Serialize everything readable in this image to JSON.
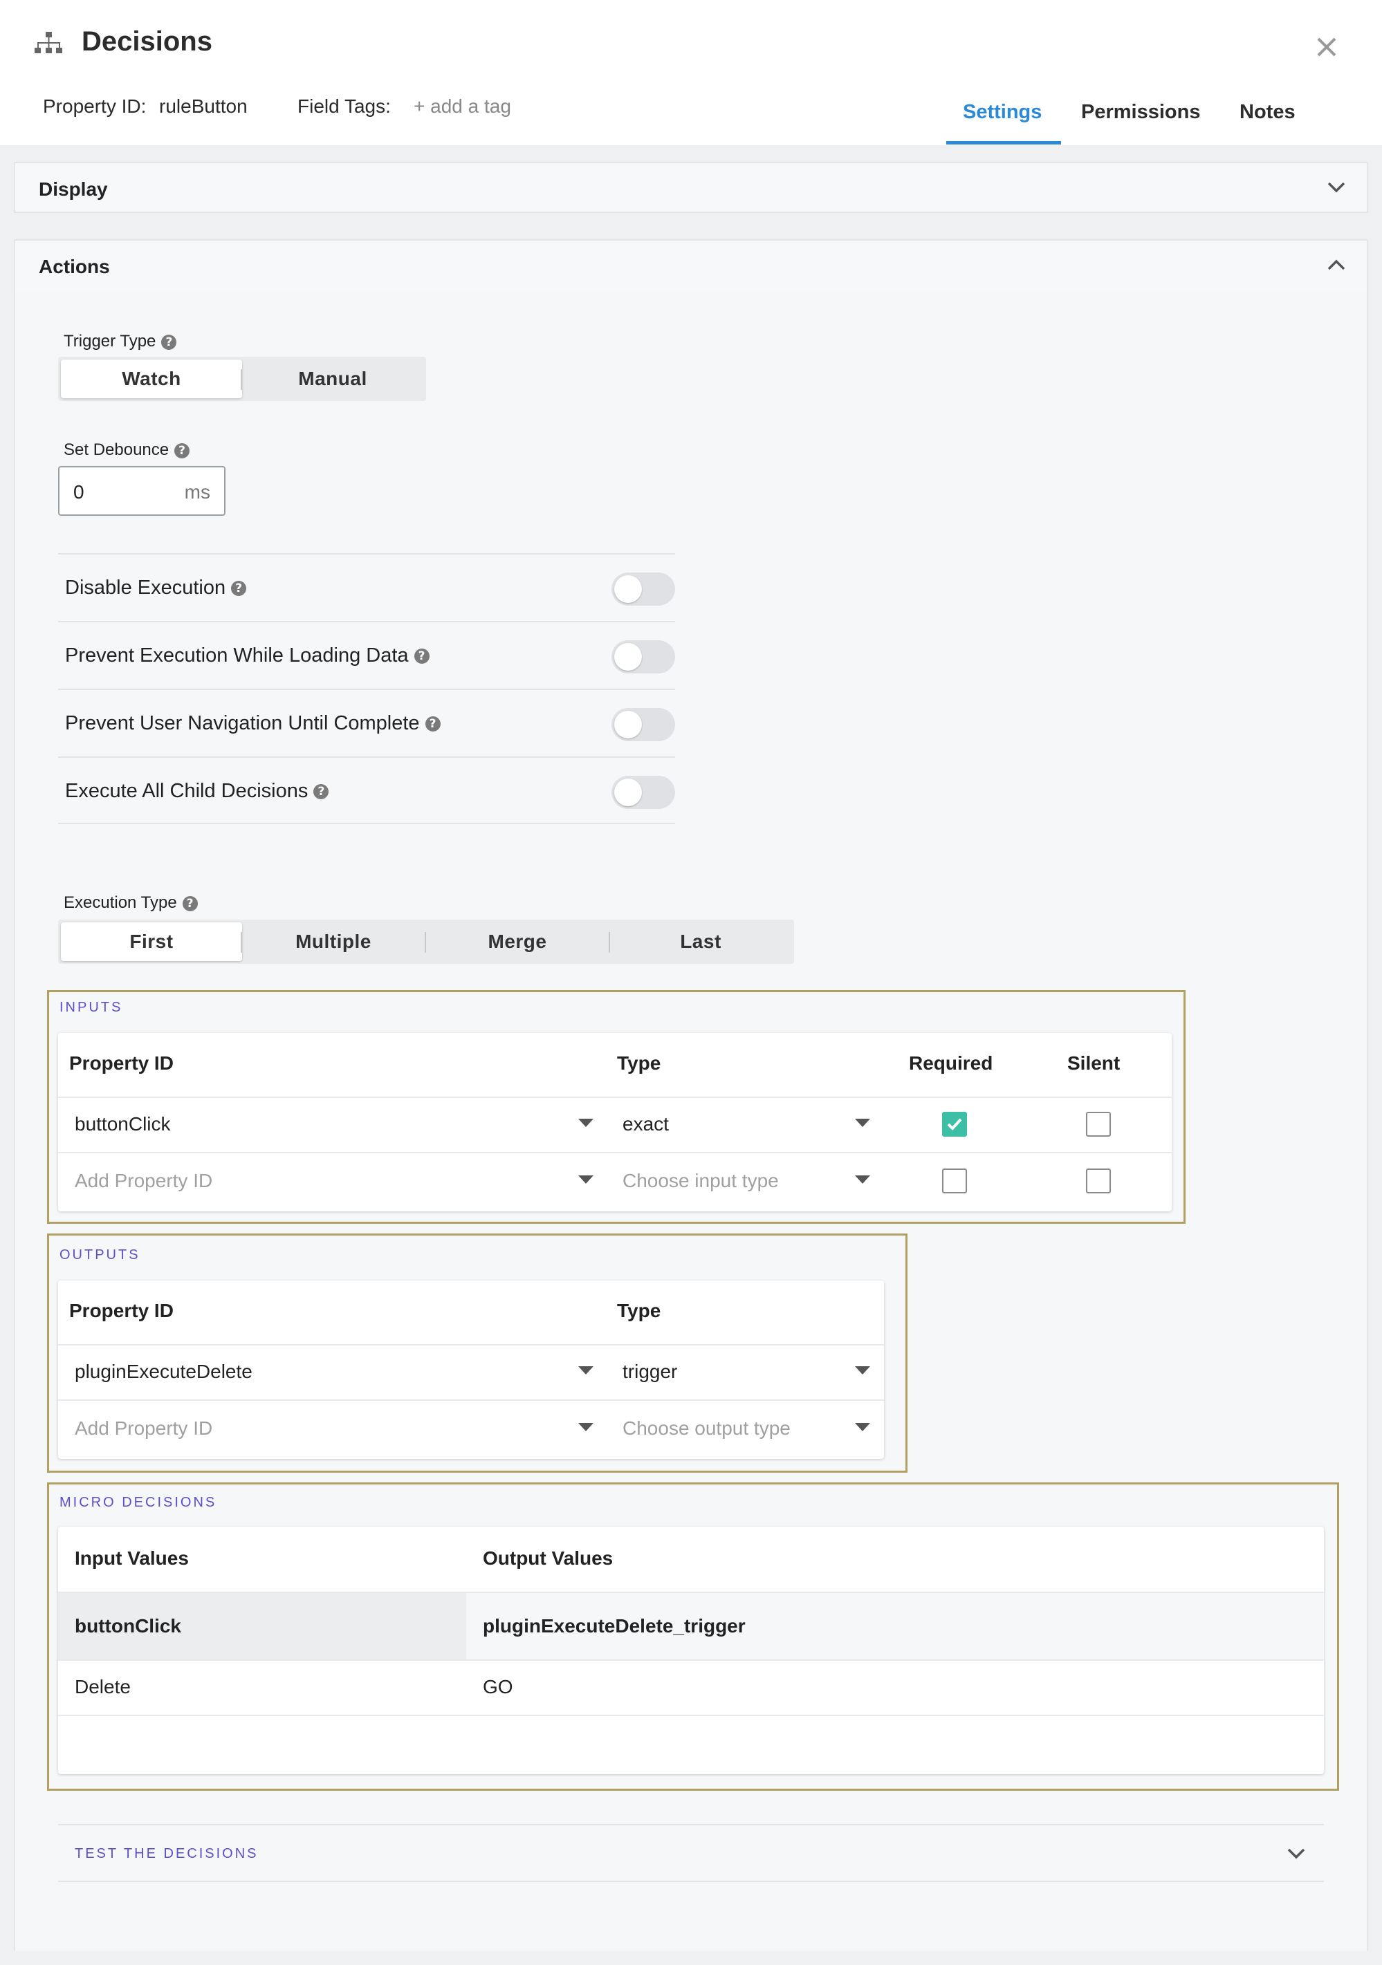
{
  "header": {
    "icon": "sitemap-icon",
    "title": "Decisions",
    "property_id_label": "Property ID:",
    "property_id_value": "ruleButton",
    "field_tags_label": "Field Tags:",
    "add_tag": "+ add a tag",
    "tabs": [
      {
        "label": "Settings",
        "active": true
      },
      {
        "label": "Permissions",
        "active": false
      },
      {
        "label": "Notes",
        "active": false
      }
    ],
    "accent_color": "#2a8ad8"
  },
  "panels": {
    "display": {
      "title": "Display",
      "expanded": false
    },
    "actions": {
      "title": "Actions",
      "expanded": true
    }
  },
  "actions": {
    "trigger_type": {
      "label": "Trigger Type",
      "options": [
        "Watch",
        "Manual"
      ],
      "selected": "Watch"
    },
    "debounce": {
      "label": "Set Debounce",
      "value": "0",
      "unit": "ms"
    },
    "toggles": [
      {
        "label": "Disable Execution",
        "on": false
      },
      {
        "label": "Prevent Execution While Loading Data",
        "on": false
      },
      {
        "label": "Prevent User Navigation Until Complete",
        "on": false
      },
      {
        "label": "Execute All Child Decisions",
        "on": false
      }
    ],
    "execution_type": {
      "label": "Execution Type",
      "options": [
        "First",
        "Multiple",
        "Merge",
        "Last"
      ],
      "selected": "First"
    }
  },
  "inputs": {
    "title": "INPUTS",
    "headers": [
      "Property ID",
      "Type",
      "Required",
      "Silent"
    ],
    "rows": [
      {
        "property_id": "buttonClick",
        "type": "exact",
        "required": true,
        "silent": false
      },
      {
        "property_id_placeholder": "Add Property ID",
        "type_placeholder": "Choose input type",
        "required": false,
        "silent": false
      }
    ]
  },
  "outputs": {
    "title": "OUTPUTS",
    "headers": [
      "Property ID",
      "Type"
    ],
    "rows": [
      {
        "property_id": "pluginExecuteDelete",
        "type": "trigger"
      },
      {
        "property_id_placeholder": "Add Property ID",
        "type_placeholder": "Choose output type"
      }
    ]
  },
  "micro_decisions": {
    "title": "MICRO DECISIONS",
    "headers": [
      "Input Values",
      "Output Values"
    ],
    "rows": [
      [
        "buttonClick",
        "pluginExecuteDelete_trigger"
      ],
      [
        "Delete",
        "GO"
      ]
    ]
  },
  "test": {
    "title": "TEST THE DECISIONS"
  },
  "colors": {
    "frame": "#b29f62",
    "section_title": "#5b4fd0",
    "checkbox_checked": "#3dbfa6"
  }
}
